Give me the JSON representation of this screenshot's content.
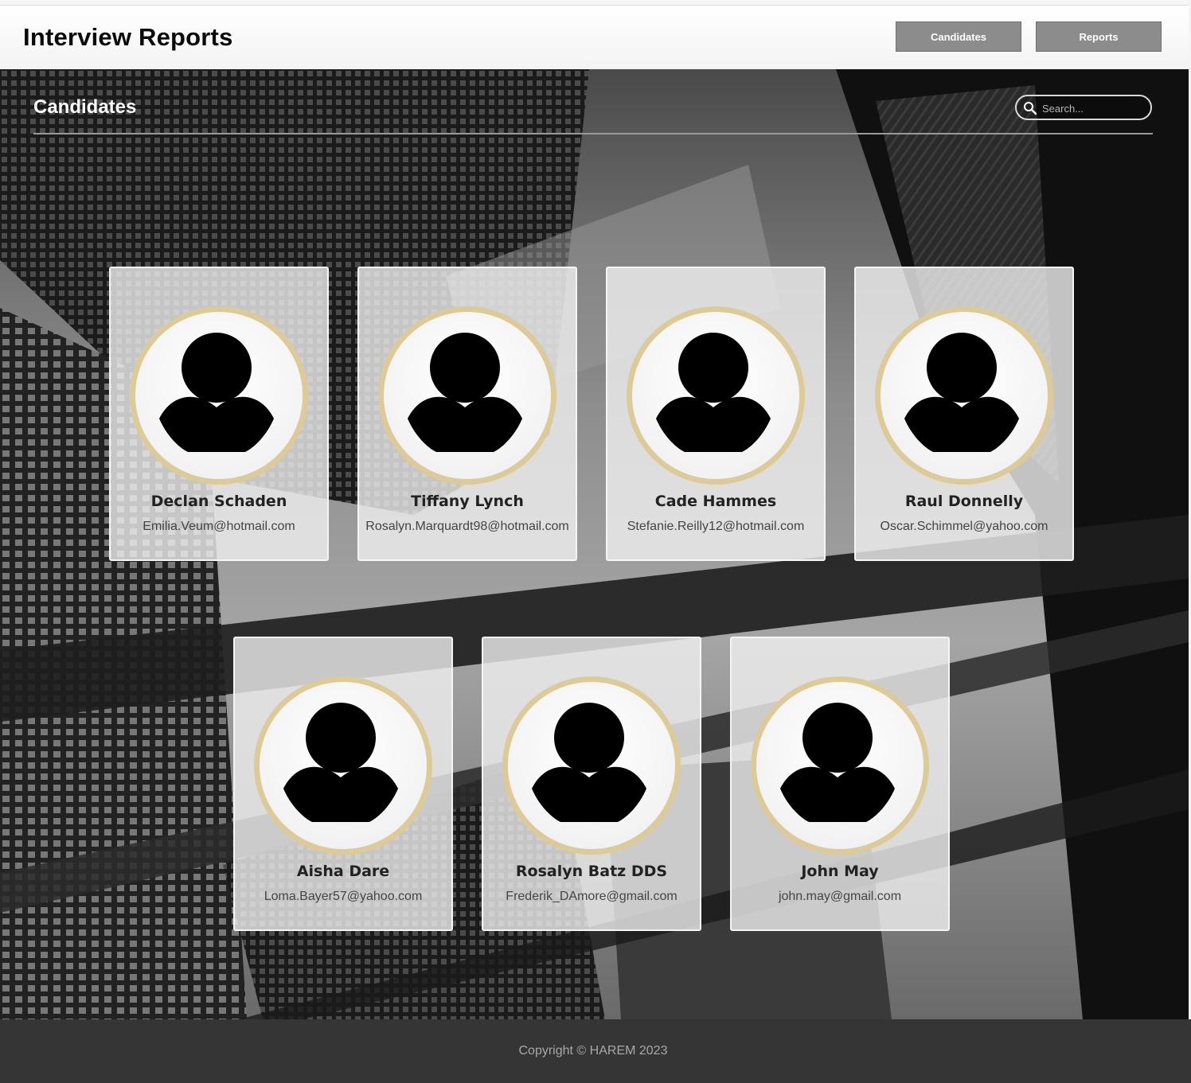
{
  "header": {
    "title": "Interview Reports",
    "nav": [
      "Candidates",
      "Reports"
    ]
  },
  "section": {
    "title": "Candidates",
    "search_placeholder": "Search..."
  },
  "candidates": [
    {
      "name": "Declan Schaden",
      "email": "Emilia.Veum@hotmail.com"
    },
    {
      "name": "Tiffany Lynch",
      "email": "Rosalyn.Marquardt98@hotmail.com"
    },
    {
      "name": "Cade Hammes",
      "email": "Stefanie.Reilly12@hotmail.com"
    },
    {
      "name": "Raul Donnelly",
      "email": "Oscar.Schimmel@yahoo.com"
    },
    {
      "name": "Aisha Dare",
      "email": "Loma.Bayer57@yahoo.com"
    },
    {
      "name": "Rosalyn Batz DDS",
      "email": "Frederik_DAmore@gmail.com"
    },
    {
      "name": "John May",
      "email": "john.may@gmail.com"
    }
  ],
  "footer": {
    "copyright": "Copyright © HAREM 2023"
  },
  "icons": {
    "avatar": "user-avatar-icon",
    "search": "search-icon"
  },
  "colors": {
    "avatar_ring": "#dccb99",
    "nav_button": "#8c8c8c",
    "footer_bg": "#353535"
  }
}
